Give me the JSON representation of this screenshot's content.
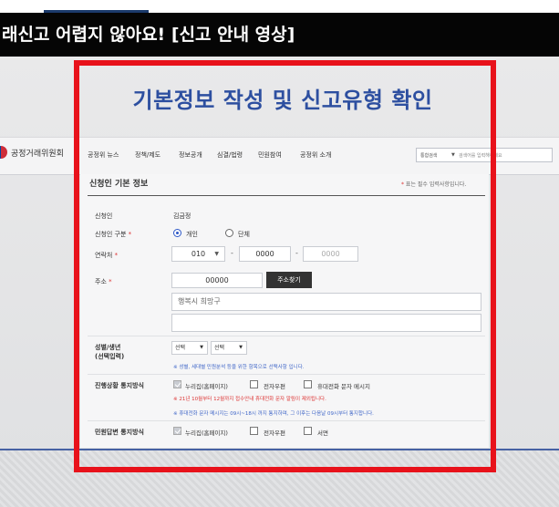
{
  "video": {
    "title": "래신고 어렵지 않아요! [신고 안내 영상]"
  },
  "slide": {
    "heading": "기본정보 작성 및 신고유형 확인"
  },
  "site": {
    "logo_text": "공정거래위원회",
    "nav": [
      "공정위 뉴스",
      "정책/제도",
      "정보공개",
      "심결/법령",
      "민원참여",
      "공정위 소개"
    ],
    "search": {
      "scope": "통합검색",
      "placeholder": "검색어를 입력해주세요"
    }
  },
  "form": {
    "section_title": "신청인 기본 정보",
    "required_note": "표는 필수 입력사항입니다.",
    "applicant": {
      "label": "신청인",
      "value": "김금정"
    },
    "applicant_type": {
      "label": "신청인 구분",
      "options": [
        "개인",
        "단체"
      ],
      "selected": "개인"
    },
    "contact": {
      "label": "연락처",
      "part1": "010",
      "part2": "0000",
      "part3": "0000"
    },
    "address": {
      "label": "주소",
      "zip": "00000",
      "search_button": "주소찾기",
      "line1": "행복시 희망구",
      "line2": ""
    },
    "gender_birth": {
      "label_line1": "성별/생년",
      "label_line2": "(선택입력)",
      "select1": "선택",
      "select2": "선택",
      "note": "※ 성별, 세대별 민원분석 등을 위한 항목으로 선택사항 입니다."
    },
    "progress_notice": {
      "label": "진행상황 통지방식",
      "options": [
        "누리집(홈페이지)",
        "전자우편",
        "휴대전화 문자 메시지"
      ],
      "checked": [
        true,
        false,
        false
      ],
      "note_red": "※ 21년 10월부터 12월까지 접수안내 휴대전화 문자 알림이 제외됩니다.",
      "note_blue": "※ 휴대전화 문자 메시지는 09시~18시 까지 통지하며, 그 이후는 다음날 09시부터 통지합니다."
    },
    "reply_notice": {
      "label": "민원답변 통지방식",
      "options": [
        "누리집(홈페이지)",
        "전자우편",
        "서면"
      ],
      "checked": [
        true,
        false,
        false
      ]
    }
  },
  "colors": {
    "highlight": "#e8121b",
    "heading": "#2d4fa0",
    "title_bar": "#050505"
  }
}
